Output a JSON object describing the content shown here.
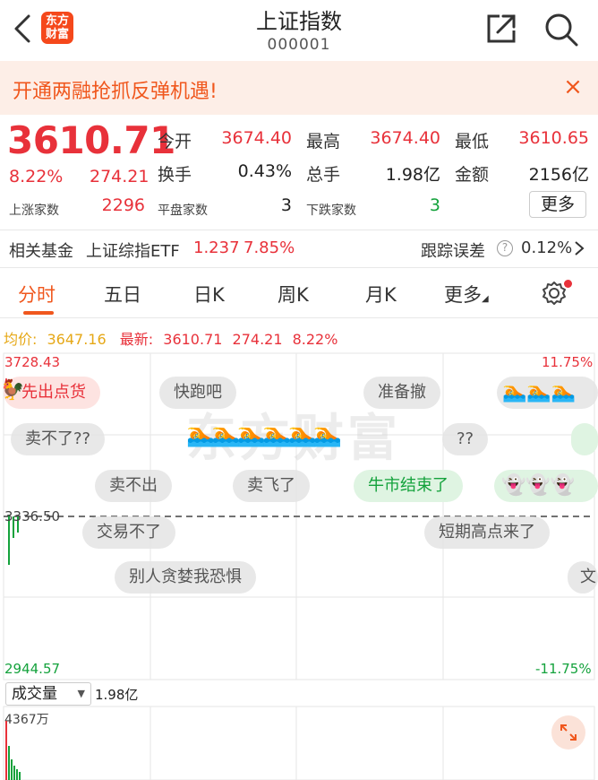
{
  "header": {
    "title": "上证指数",
    "code": "000001",
    "logo_text_1": "东方",
    "logo_text_2": "财富"
  },
  "banner": {
    "text": "开通两融抢抓反弹机遇!",
    "close_glyph": "×"
  },
  "quote": {
    "price": "3610.71",
    "change_pct": "8.22%",
    "change_abs": "274.21",
    "stats": [
      {
        "label": "今开",
        "value": "3674.40"
      },
      {
        "label": "最高",
        "value": "3674.40"
      },
      {
        "label": "最低",
        "value": "3610.65"
      },
      {
        "label": "换手",
        "value": "0.43%"
      },
      {
        "label": "总手",
        "value": "1.98亿"
      },
      {
        "label": "金额",
        "value": "2156亿"
      }
    ],
    "up_count_label": "上涨家数",
    "up_count": "2296",
    "flat_count_label": "平盘家数",
    "flat_count": "3",
    "down_count_label": "下跌家数",
    "down_count": "3",
    "more_label": "更多"
  },
  "fund": {
    "label": "相关基金",
    "name": "上证综指ETF",
    "price": "1.237",
    "pct": "7.85%",
    "tracking_label": "跟踪误差",
    "tracking_value": "0.12%"
  },
  "tabs": [
    "分时",
    "五日",
    "日K",
    "周K",
    "月K",
    "更多"
  ],
  "chart": {
    "avg_label": "均价:",
    "avg_value": "3647.16",
    "latest_label": "最新:",
    "latest_value": "3610.71",
    "latest_change": "274.21",
    "latest_pct": "8.22%",
    "y_top": "3728.43",
    "y_mid": "3336.50",
    "y_bottom": "2944.57",
    "pct_top": "11.75%",
    "pct_bottom": "-11.75%",
    "volume_selector": "成交量",
    "volume_value": "1.98亿",
    "volume_max": "4367万",
    "watermark": "东方财富"
  },
  "danmaku": [
    {
      "text": "先出点货"
    },
    {
      "text": "快跑吧"
    },
    {
      "text": "准备撤"
    },
    {
      "text": "卖不了??"
    },
    {
      "text": "??"
    },
    {
      "text": "卖不出"
    },
    {
      "text": "卖飞了"
    },
    {
      "text": "牛市结束了"
    },
    {
      "text": "交易不了"
    },
    {
      "text": "短期高点来了"
    },
    {
      "text": "别人贪婪我恐惧"
    },
    {
      "text": "文"
    }
  ],
  "colors": {
    "red": "#e8313a",
    "green": "#14a23c",
    "accent": "#f0571d",
    "avg_line": "#e6a817"
  }
}
